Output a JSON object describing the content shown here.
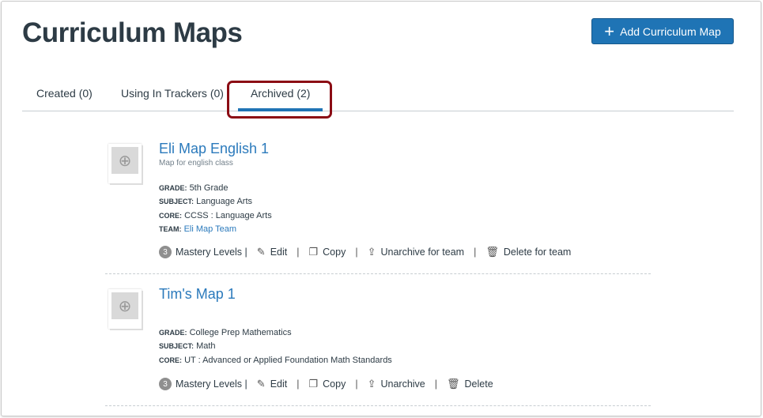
{
  "header": {
    "title": "Curriculum Maps",
    "add_button": "Add Curriculum Map"
  },
  "tabs": [
    {
      "label": "Created (0)"
    },
    {
      "label": "Using In Trackers (0)"
    },
    {
      "label": "Archived (2)",
      "active": true
    }
  ],
  "maps": [
    {
      "title": "Eli Map English 1",
      "description": "Map for english class",
      "grade_label": "GRADE:",
      "grade": "5th Grade",
      "subject_label": "SUBJECT:",
      "subject": "Language Arts",
      "core_label": "CORE:",
      "core": "CCSS : Language Arts",
      "team_label": "TEAM:",
      "team": "Eli Map Team",
      "mastery_count": "3",
      "mastery_label": "Mastery Levels |",
      "edit": "Edit",
      "copy": "Copy",
      "unarchive": "Unarchive for team",
      "delete": "Delete for team"
    },
    {
      "title": "Tim's Map 1",
      "grade_label": "GRADE:",
      "grade": "College Prep Mathematics",
      "subject_label": "SUBJECT:",
      "subject": "Math",
      "core_label": "CORE:",
      "core": "UT : Advanced or Applied Foundation Math Standards",
      "mastery_count": "3",
      "mastery_label": "Mastery Levels |",
      "edit": "Edit",
      "copy": "Copy",
      "unarchive": "Unarchive",
      "delete": "Delete"
    }
  ],
  "separator": "|"
}
